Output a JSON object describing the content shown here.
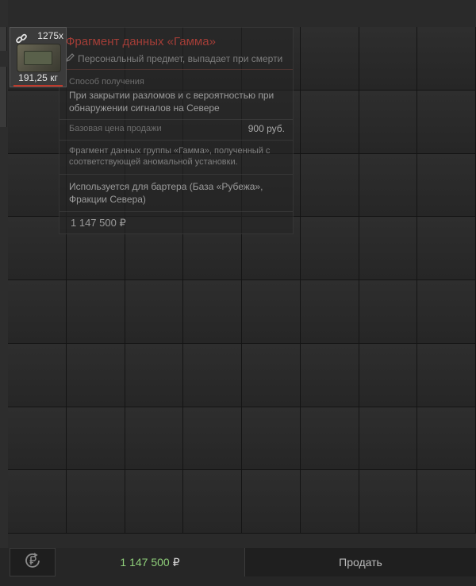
{
  "item": {
    "count": "1275x",
    "weight": "191,25 кг",
    "icon": "link-icon"
  },
  "tooltip": {
    "title": "Фрагмент данных «Гамма»",
    "subtitle": "Персональный предмет, выпадает при смерти",
    "acquire_label": "Способ получения",
    "acquire_text": "При закрытии разломов и с вероятностью при обнаружении сигналов на Севере",
    "base_price_label": "Базовая цена продажи",
    "base_price_value": "900 руб.",
    "description": "Фрагмент данных группы «Гамма», полученный с соответствующей аномальной установки.",
    "usage": "Используется для бартера (База «Рубежа», Фракции Севера)",
    "total": "1 147 500 ₽"
  },
  "footer": {
    "total_amount": "1 147 500",
    "currency": "₽",
    "sell_label": "Продать",
    "refresh_icon": "ruble-refresh-icon"
  },
  "colors": {
    "title": "#b9423a",
    "amount": "#8fcf7a",
    "background": "#2a2a2a"
  }
}
